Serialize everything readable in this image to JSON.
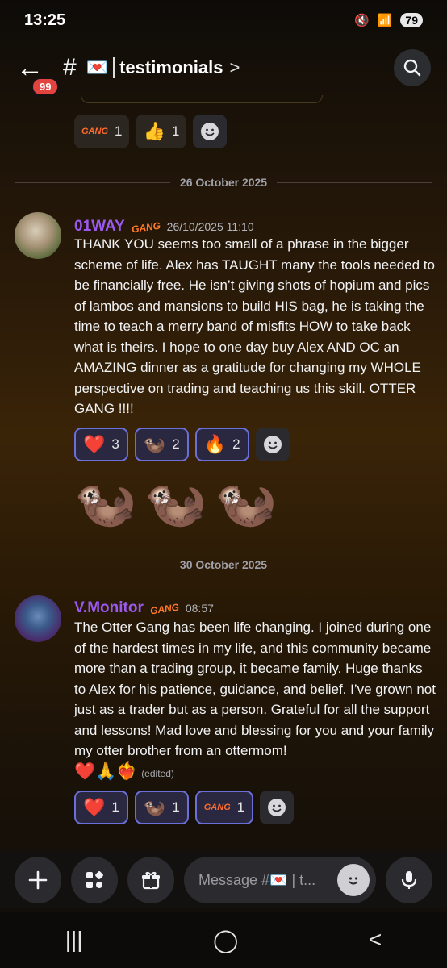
{
  "status": {
    "time": "13:25",
    "battery": "79"
  },
  "header": {
    "unread_count": "99",
    "hash": "#",
    "channel_emoji": "💌",
    "channel_name": "testimonials",
    "chevron": ">"
  },
  "prev_reactions": [
    {
      "emoji": "GANG",
      "count": "1"
    },
    {
      "emoji": "👍",
      "count": "1"
    }
  ],
  "dividers": [
    "26 October 2025",
    "30 October 2025"
  ],
  "messages": [
    {
      "username": "01WAY",
      "badge": "GANG",
      "timestamp": "26/10/2025 11:10",
      "body": "THANK YOU seems too small of a phrase in the bigger scheme of life. Alex has TAUGHT many the tools needed to be financially free. He isn’t giving shots of hopium and pics of lambos and mansions to build HIS bag, he is taking the time to teach a merry band of misfits HOW to take back what is theirs. I hope to one day buy Alex AND OC an AMAZING dinner as a gratitude for changing my WHOLE perspective on trading and teaching us this skill. OTTER GANG !!!!",
      "reactions": [
        {
          "emoji": "❤️",
          "count": "3"
        },
        {
          "emoji": "🦦",
          "count": "2"
        },
        {
          "emoji": "🔥",
          "count": "2"
        }
      ],
      "followup_emojis": [
        "🦦",
        "🦦",
        "🦦"
      ]
    },
    {
      "username": "V.Monitor",
      "badge": "GANG",
      "timestamp": "08:57",
      "body": "The Otter Gang has been life changing. I joined during one of the hardest times in my life, and this community became more than a trading group, it became family. Huge thanks to Alex for his patience, guidance, and belief. I’ve grown not just as a trader but as a person. Grateful for all the support and lessons! Mad love and blessing for you and your family my otter brother from an ottermom!",
      "trailing_emojis": "❤️🙏❤️‍🔥",
      "edited": "(edited)",
      "reactions": [
        {
          "emoji": "❤️",
          "count": "1"
        },
        {
          "emoji": "🦦",
          "count": "1"
        },
        {
          "emoji": "GANG",
          "count": "1"
        }
      ]
    }
  ],
  "composer": {
    "placeholder": "Message #💌 | t..."
  },
  "colors": {
    "accent": "#9b59f0",
    "badge_red": "#e2433f",
    "reaction_border": "#6b6fd8"
  }
}
